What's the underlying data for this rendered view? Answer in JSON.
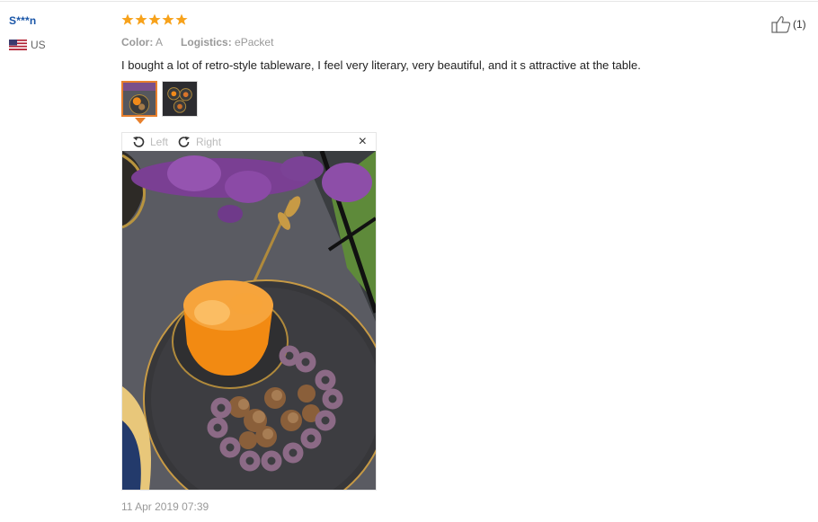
{
  "reviewer": {
    "name": "S***n",
    "country_code": "US"
  },
  "rating": {
    "stars": 5,
    "max": 5,
    "color": "#f7a21b"
  },
  "attributes": {
    "color_label": "Color:",
    "color_value": "A",
    "logistics_label": "Logistics:",
    "logistics_value": "ePacket"
  },
  "review_text": "I bought a lot of retro-style tableware, I feel very literary, very beautiful, and it s attractive at the table.",
  "images": {
    "count": 2,
    "selected_index": 0
  },
  "viewer": {
    "rotate_left_label": "Left",
    "rotate_right_label": "Right",
    "close_label": "×",
    "photo_description_icon": "photo-orange-plate"
  },
  "date": "11 Apr 2019 07:39",
  "helpful": {
    "count_label": "(1)",
    "icon": "thumbs-up-icon"
  },
  "colors": {
    "accent": "#e8802d",
    "username": "#1a56a8",
    "muted": "#999999"
  }
}
